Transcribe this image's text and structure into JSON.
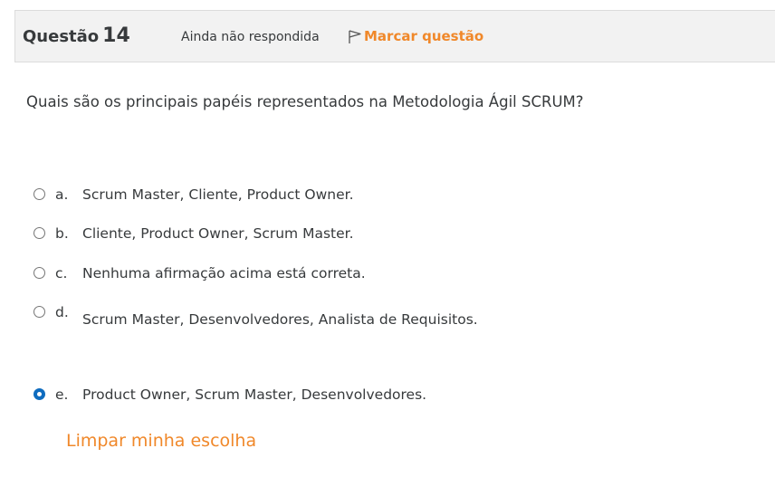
{
  "question": {
    "label": "Questão",
    "number": "14",
    "state": "Ainda não respondida",
    "flag_label": "Marcar questão",
    "text": "Quais são os principais papéis representados na Metodologia Ágil SCRUM?"
  },
  "options": [
    {
      "letter": "a.",
      "text": "Scrum Master,  Cliente, Product Owner.",
      "selected": false
    },
    {
      "letter": "b.",
      "text": "Cliente, Product Owner, Scrum Master.",
      "selected": false
    },
    {
      "letter": "c.",
      "text": "Nenhuma afirmação acima está correta.",
      "selected": false
    },
    {
      "letter": "d.",
      "text": "Scrum Master, Desenvolvedores, Analista de Requisitos.",
      "selected": false
    },
    {
      "letter": "e.",
      "text": "Product Owner, Scrum Master, Desenvolvedores.",
      "selected": true
    }
  ],
  "clear_choice_label": "Limpar minha escolha",
  "colors": {
    "accent": "#f0882a",
    "radio_selected": "#0f6cbf",
    "header_bg": "#f2f2f2",
    "text": "#373a3c"
  }
}
